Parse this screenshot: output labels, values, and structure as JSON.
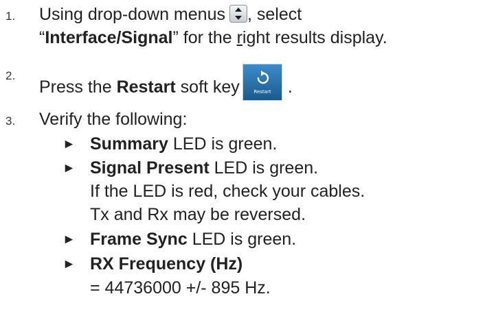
{
  "steps": [
    {
      "number": "1.",
      "line1_pre": "Using drop-down menus",
      "line1_post": ", select",
      "line2_open_quote": "“",
      "line2_bold": "Interface/Signal",
      "line2_close_quote": "”",
      "line2_rest_a": " for the ",
      "line2_underlined": "r",
      "line2_rest_b": "ight results display.",
      "icon": "dropdown-updown-icon"
    },
    {
      "number": "2.",
      "pre": "Press the ",
      "bold": "Restart",
      "post": " soft key",
      "trailing": ".",
      "icon": "restart-softkey-icon",
      "icon_label": "Restart"
    },
    {
      "number": "3.",
      "text": "Verify the following:"
    }
  ],
  "bullets": [
    {
      "bold": "Summary",
      "rest": " LED is green."
    },
    {
      "bold": "Signal Present",
      "rest": " LED is green."
    },
    {
      "bold": "Frame Sync",
      "rest": " LED is green."
    },
    {
      "bold": "RX Frequency (Hz)",
      "rest": ""
    }
  ],
  "continuations": {
    "signal_present_1": "If the LED is red, check your cables.",
    "signal_present_2": "Tx and Rx may be reversed.",
    "rx_frequency": "= 44736000 +/- 895 Hz."
  },
  "bullet_icon": "right-pointer-icon",
  "colors": {
    "text": "#222222",
    "restart_button_top": "#2e7fb8",
    "restart_button_bottom": "#1a5f93",
    "dropdown_icon_bg": "#d9dde2"
  }
}
